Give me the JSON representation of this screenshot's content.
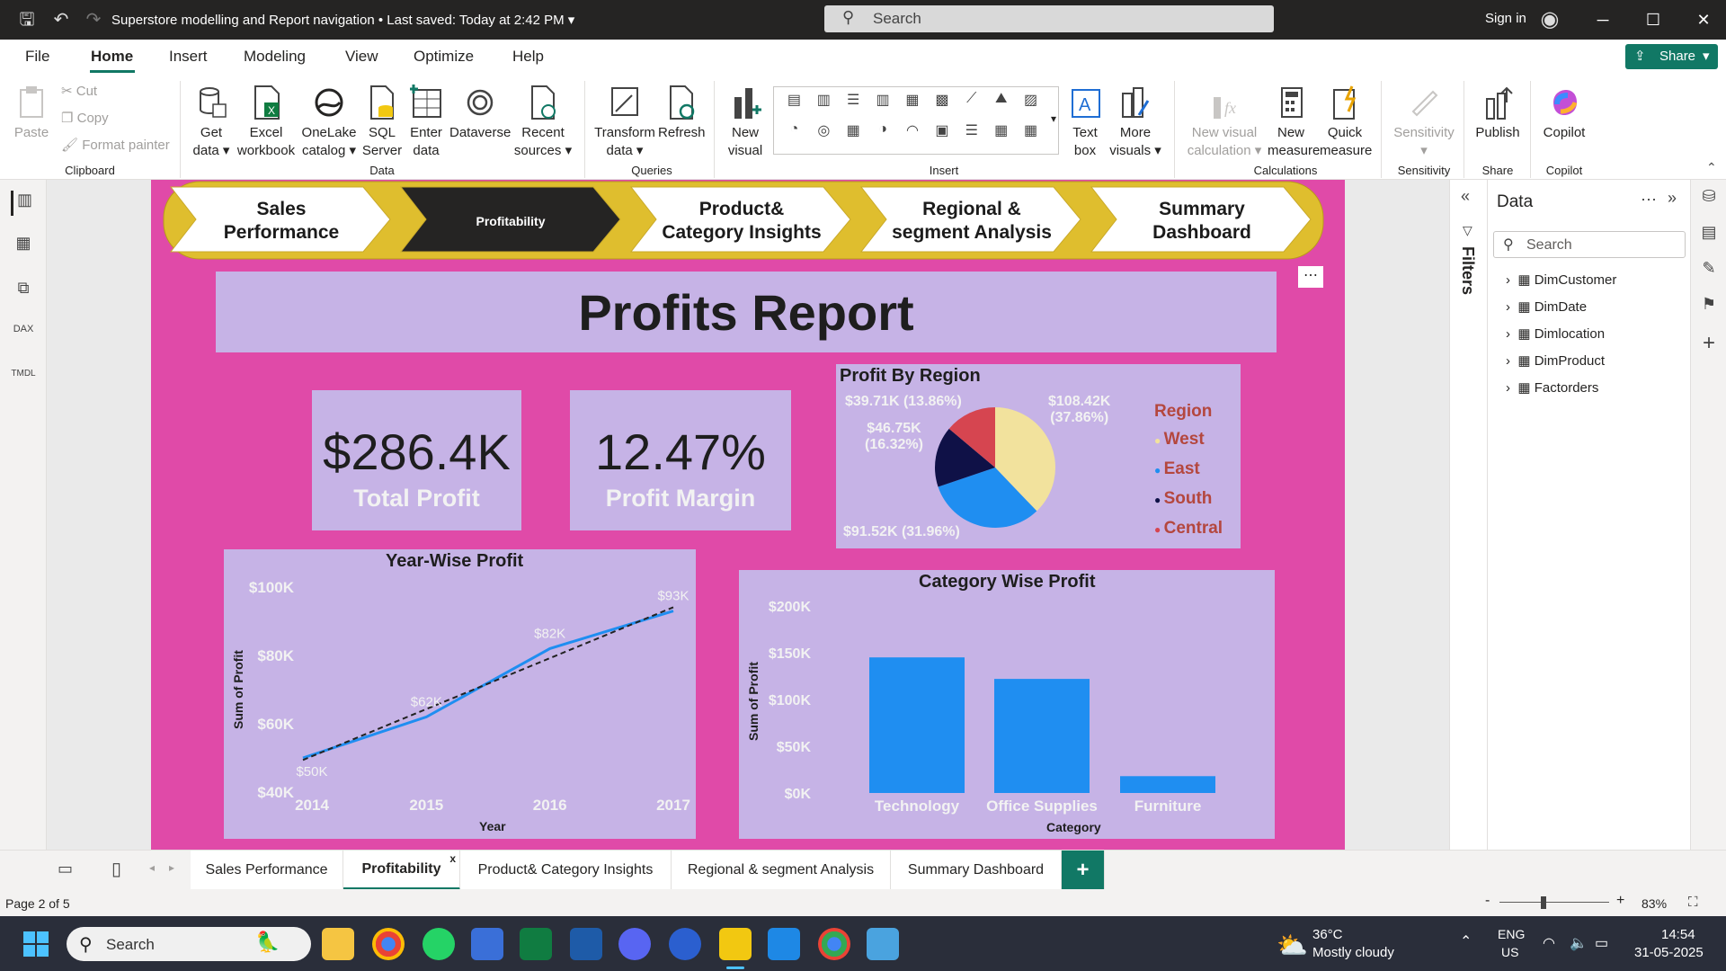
{
  "titlebar": {
    "doc_title": "Superstore modelling and Report navigation",
    "last_saved": "Last saved: Today at 2:42 PM",
    "search_placeholder": "Search",
    "signin": "Sign in"
  },
  "menu": {
    "file": "File",
    "home": "Home",
    "insert": "Insert",
    "modeling": "Modeling",
    "view": "View",
    "optimize": "Optimize",
    "help": "Help",
    "share": "Share"
  },
  "ribbon": {
    "paste": "Paste",
    "cut": "Cut",
    "copy": "Copy",
    "format_painter": "Format painter",
    "clipboard": "Clipboard",
    "get_data": [
      "Get",
      "data"
    ],
    "excel": [
      "Excel",
      "workbook"
    ],
    "onelake": [
      "OneLake",
      "catalog"
    ],
    "sql": [
      "SQL",
      "Server"
    ],
    "enter": [
      "Enter",
      "data"
    ],
    "dataverse": "Dataverse",
    "recent": [
      "Recent",
      "sources"
    ],
    "data_group": "Data",
    "transform": [
      "Transform",
      "data"
    ],
    "refresh": "Refresh",
    "queries": "Queries",
    "new_visual": [
      "New",
      "visual"
    ],
    "insert_group": "Insert",
    "text_box": [
      "Text",
      "box"
    ],
    "more_visuals": [
      "More",
      "visuals"
    ],
    "new_visual_calc": [
      "New visual",
      "calculation"
    ],
    "new_measure": [
      "New",
      "measure"
    ],
    "quick_measure": [
      "Quick",
      "measure"
    ],
    "calculations": "Calculations",
    "sensitivity": "Sensitivity",
    "sensitivity_group": "Sensitivity",
    "publish": "Publish",
    "share_group": "Share",
    "copilot": "Copilot",
    "copilot_group": "Copilot"
  },
  "nav": {
    "sales": [
      "Sales",
      "Performance"
    ],
    "profitability": "Profitability",
    "product": [
      "Product&",
      "Category Insights"
    ],
    "regional": [
      "Regional &",
      "segment Analysis"
    ],
    "summary": [
      "Summary",
      "Dashboard"
    ]
  },
  "report": {
    "title": "Profits Report",
    "total_profit_value": "$286.4K",
    "total_profit_label": "Total Profit",
    "margin_value": "12.47%",
    "margin_label": "Profit Margin",
    "more_options": "⋯"
  },
  "colors": {
    "canvas": "#e04aa8",
    "card": "#c6b3e6",
    "nav_yellow": "#dfbe2e",
    "west": "#f2e29d",
    "east": "#1f8ef1",
    "south": "#0f1147",
    "central": "#d64550",
    "bar": "#1f8ef1"
  },
  "chart_data": [
    {
      "type": "pie",
      "title": "Profit By Region",
      "legend_title": "Region",
      "legend_position": "right",
      "slices": [
        {
          "name": "West",
          "value": 108.42,
          "label": "$108.42K",
          "pct": "(37.86%)"
        },
        {
          "name": "East",
          "value": 91.52,
          "label": "$91.52K (31.96%)",
          "pct": ""
        },
        {
          "name": "South",
          "value": 46.75,
          "label": "$46.75K",
          "pct": "(16.32%)"
        },
        {
          "name": "Central",
          "value": 39.71,
          "label": "$39.71K (13.86%)",
          "pct": ""
        }
      ]
    },
    {
      "type": "line",
      "title": "Year-Wise Profit",
      "xlabel": "Year",
      "ylabel": "Sum of Profit",
      "x": [
        "2014",
        "2015",
        "2016",
        "2017"
      ],
      "values": [
        50,
        62,
        82,
        93
      ],
      "labels": [
        "$50K",
        "$62K",
        "$82K",
        "$93K"
      ],
      "yticks": [
        "$40K",
        "$60K",
        "$80K",
        "$100K"
      ],
      "ylim": [
        40,
        100
      ],
      "trendline": true
    },
    {
      "type": "bar",
      "title": "Category Wise Profit",
      "xlabel": "Category",
      "ylabel": "Sum of Profit",
      "categories": [
        "Technology",
        "Office Supplies",
        "Furniture"
      ],
      "values": [
        145,
        122,
        18
      ],
      "yticks": [
        "$0K",
        "$50K",
        "$100K",
        "$150K",
        "$200K"
      ],
      "ylim": [
        0,
        200
      ]
    }
  ],
  "filters_label": "Filters",
  "data_pane": {
    "title": "Data",
    "search_placeholder": "Search",
    "tables": [
      "DimCustomer",
      "DimDate",
      "Dimlocation",
      "DimProduct",
      "Factorders"
    ]
  },
  "page_tabs": [
    "Sales Performance",
    "Profitability",
    "Product& Category Insights",
    "Regional & segment Analysis",
    "Summary Dashboard"
  ],
  "status": {
    "page": "Page 2 of 5",
    "zoom": "83%"
  },
  "taskbar": {
    "search": "Search",
    "temp": "36°C",
    "weather": "Mostly cloudy",
    "lang1": "ENG",
    "lang2": "US",
    "time": "14:54",
    "date": "31-05-2025"
  }
}
